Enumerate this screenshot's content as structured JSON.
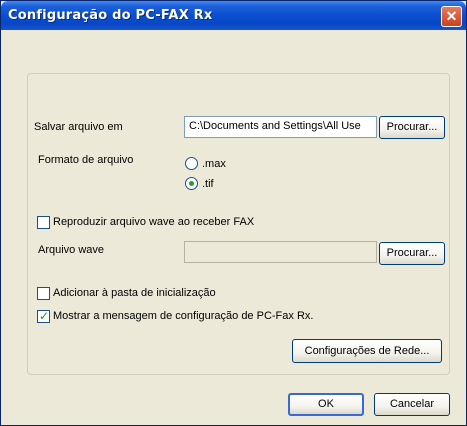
{
  "window": {
    "title": "Configuração do PC-FAX Rx",
    "close_glyph": "✕"
  },
  "save": {
    "label": "Salvar arquivo em",
    "path_value": "C:\\Documents and Settings\\All Use",
    "browse_label": "Procurar..."
  },
  "format": {
    "label": "Formato de arquivo",
    "options": [
      {
        "label": ".max",
        "selected": false
      },
      {
        "label": ".tif",
        "selected": true
      }
    ]
  },
  "wave": {
    "checkbox_label": "Reproduzir arquivo wave ao receber FAX",
    "checked": false,
    "file_label": "Arquivo wave",
    "file_value": "",
    "browse_label": "Procurar..."
  },
  "startup": {
    "label": "Adicionar à pasta de inicialização",
    "checked": false
  },
  "show_message": {
    "label": "Mostrar a mensagem de configuração de PC-Fax Rx.",
    "checked": true,
    "check_glyph": "✓"
  },
  "network_button_label": "Configurações de Rede...",
  "ok_label": "OK",
  "cancel_label": "Cancelar",
  "colors": {
    "title_bar": "#0a4fd0",
    "face": "#ece9d8",
    "checked_accent": "#21a121",
    "close_button": "#c9411b"
  }
}
